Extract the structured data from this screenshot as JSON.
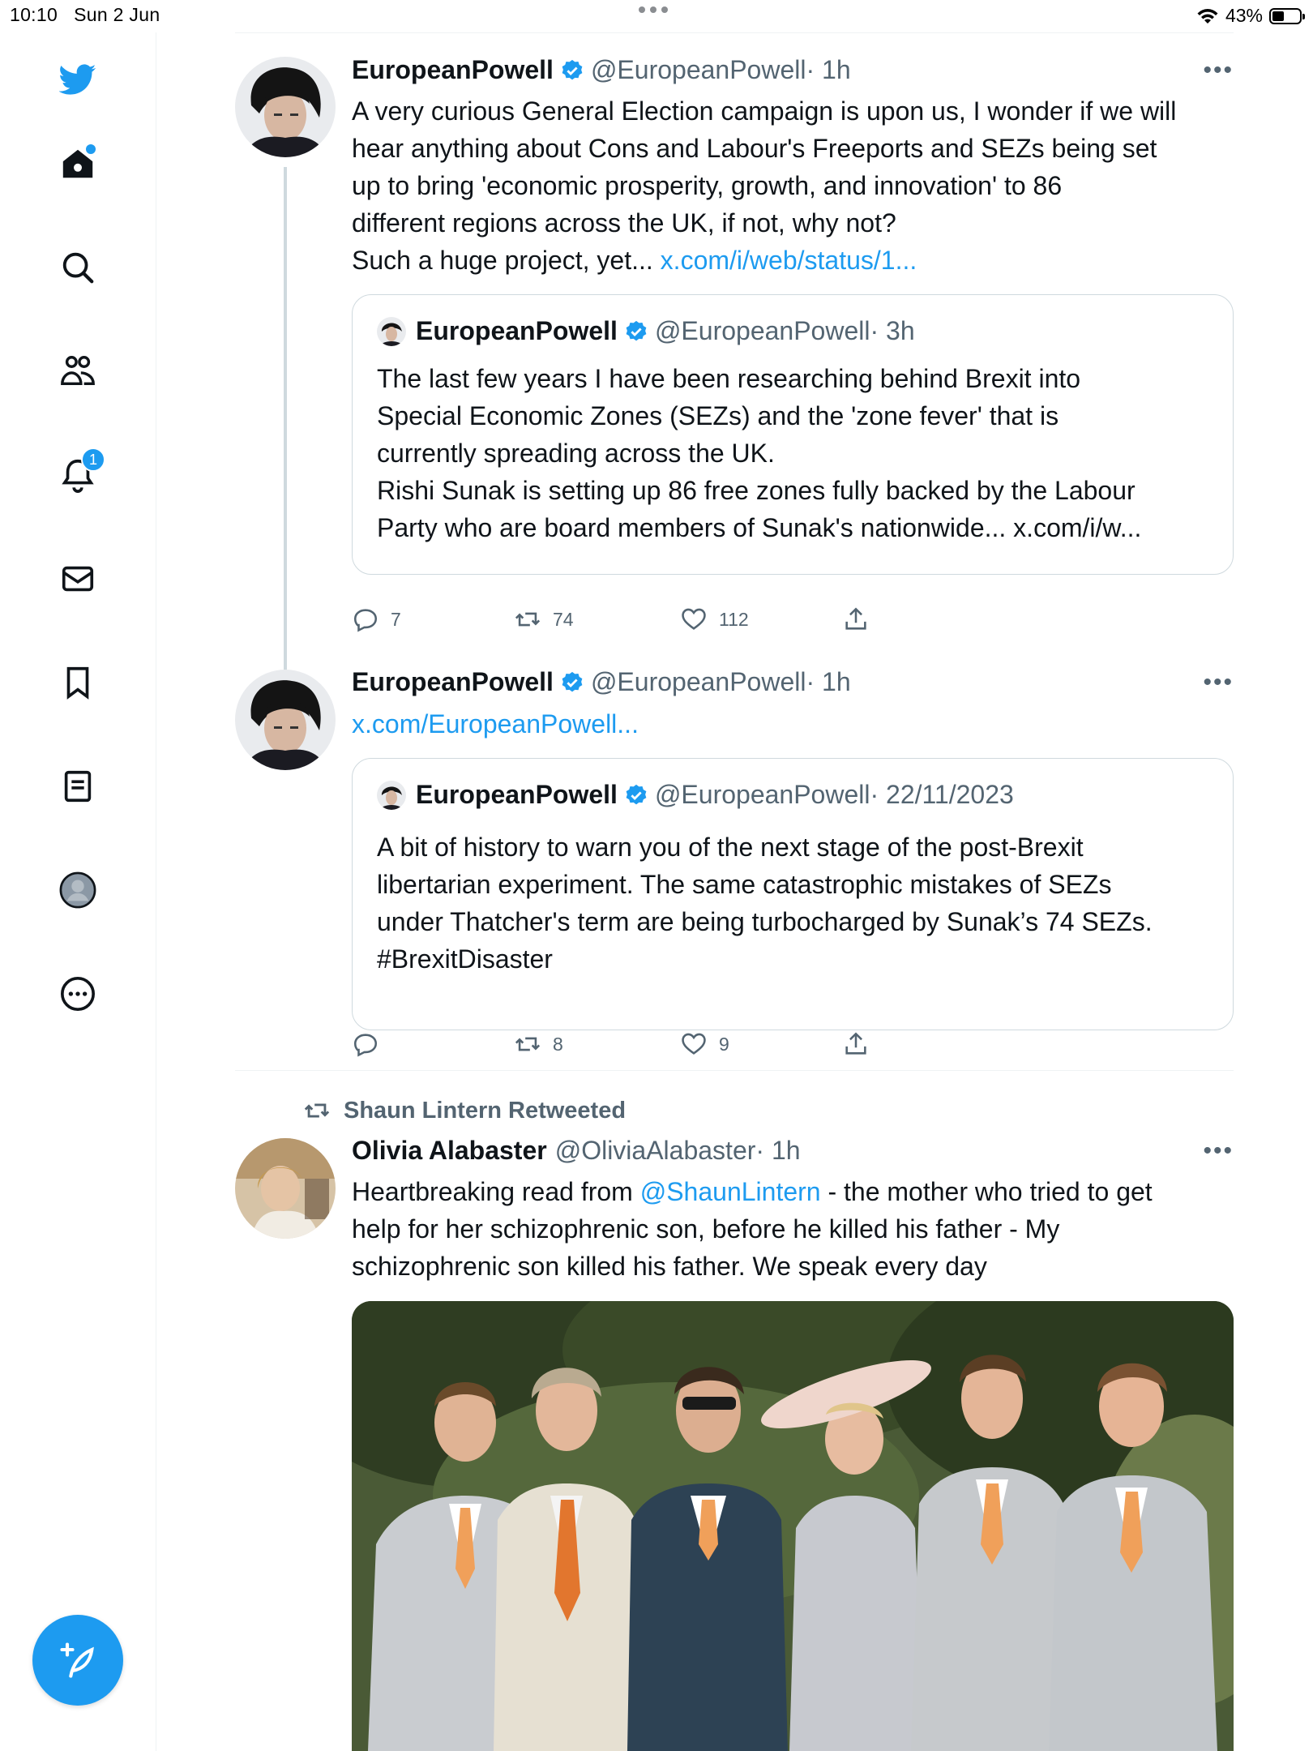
{
  "status_bar": {
    "time": "10:10",
    "date": "Sun 2 Jun",
    "battery": "43%",
    "battery_level": 0.43
  },
  "sidebar": {
    "items": [
      {
        "name": "twitter-logo-icon"
      },
      {
        "name": "home-icon"
      },
      {
        "name": "search-icon"
      },
      {
        "name": "communities-icon"
      },
      {
        "name": "notifications-icon",
        "badge": "1"
      },
      {
        "name": "messages-icon"
      },
      {
        "name": "bookmarks-icon"
      },
      {
        "name": "lists-icon"
      },
      {
        "name": "profile-icon"
      },
      {
        "name": "more-icon"
      }
    ],
    "compose": {
      "icon": "compose-feather-icon"
    }
  },
  "tweets": [
    {
      "name": "EuropeanPowell",
      "handle": "@EuropeanPowell",
      "time": "· 1h",
      "text_lines": [
        "A very curious General Election campaign is upon us, I wonder if we will",
        "hear anything about Cons and Labour's Freeports and SEZs being set",
        "up to bring 'economic prosperity, growth, and innovation' to 86",
        "different regions across the UK, if not, why not?",
        "Such a huge project, yet..."
      ],
      "link": "x.com/i/web/status/1...",
      "quote": {
        "name": "EuropeanPowell",
        "handle": "@EuropeanPowell",
        "time": "· 3h",
        "text_lines": [
          "The last few years I have been researching behind Brexit into",
          "Special Economic Zones (SEZs) and the 'zone fever' that is",
          "currently spreading across the UK.",
          "Rishi Sunak is setting up 86 free zones fully backed by the Labour",
          "Party who are board members of Sunak's nationwide... x.com/i/w..."
        ]
      },
      "replies": "7",
      "retweets": "74",
      "likes": "112"
    },
    {
      "name": "EuropeanPowell",
      "handle": "@EuropeanPowell",
      "time": "· 1h",
      "link": "x.com/EuropeanPowell...",
      "quote": {
        "name": "EuropeanPowell",
        "handle": "@EuropeanPowell",
        "time": "· 22/11/2023",
        "text_lines": [
          "A bit of history to warn you of the next stage of the post-Brexit",
          "libertarian experiment. The same catastrophic mistakes of SEZs",
          "under Thatcher's term are being turbocharged by Sunak’s 74 SEZs.",
          "#BrexitDisaster"
        ]
      },
      "replies": "",
      "retweets": "8",
      "likes": "9"
    },
    {
      "retweeted_by": "Shaun Lintern Retweeted",
      "name": "Olivia Alabaster",
      "handle": "@OliviaAlabaster",
      "time": "· 1h",
      "text_pre": "Heartbreaking read from ",
      "mention": "@ShaunLintern",
      "text_post": " - the mother who tried to get",
      "text_lines": [
        "help for her schizophrenic son, before he killed his father - My",
        "schizophrenic son killed his father. We speak every day"
      ]
    }
  ],
  "colors": {
    "accent": "#1d9bf0",
    "text": "#0f1419",
    "muted": "#536471",
    "border": "#cfd9de"
  }
}
